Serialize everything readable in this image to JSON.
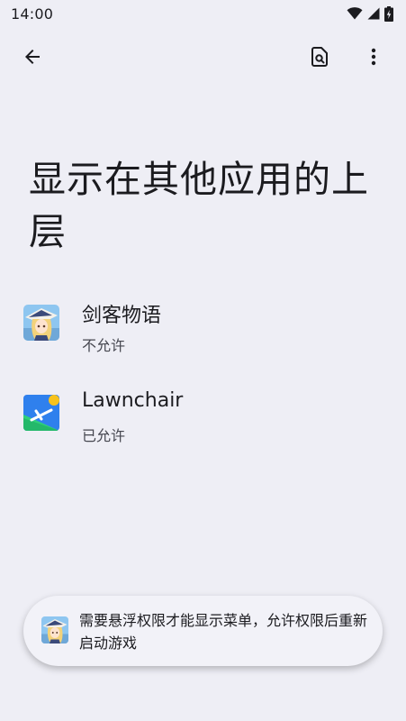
{
  "status_bar": {
    "time": "14:00",
    "icons": [
      "wifi-icon",
      "cell-signal-icon",
      "battery-charging-icon"
    ]
  },
  "app_bar": {
    "back_icon": "arrow-back-icon",
    "search_icon": "search-settings-icon",
    "more_icon": "more-vert-icon"
  },
  "page": {
    "title": "显示在其他应用的上层"
  },
  "apps": [
    {
      "name": "剑客物语",
      "status": "不允许",
      "icon": "game-character-icon"
    },
    {
      "name": "Lawnchair",
      "status": "已允许",
      "icon": "lawnchair-icon"
    }
  ],
  "toast": {
    "message": "需要悬浮权限才能显示菜单，允许权限后重新启动游戏",
    "icon": "game-character-icon"
  },
  "colors": {
    "background": "#eeeef5",
    "text_primary": "#1b1b1f",
    "text_secondary": "#45464f",
    "lawnchair_blue": "#2f80ed",
    "lawnchair_green": "#2fd07a",
    "lawnchair_yellow": "#f7c21c"
  }
}
